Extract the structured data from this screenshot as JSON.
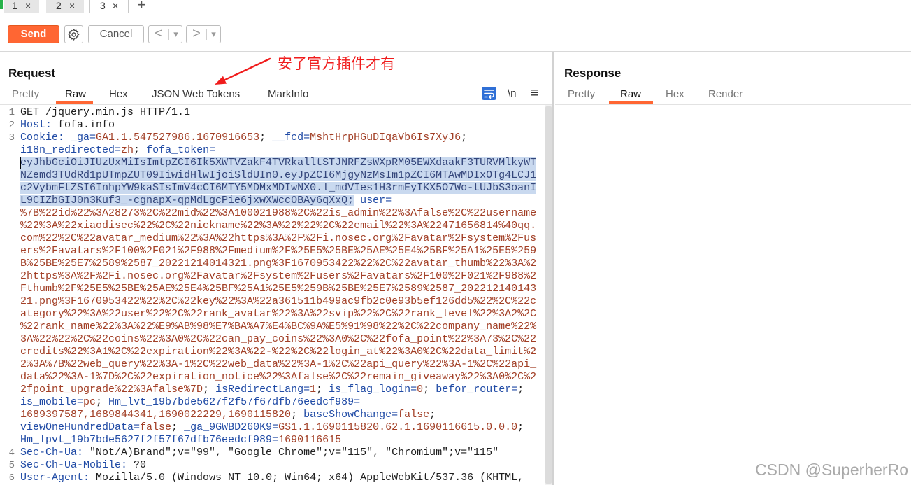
{
  "tabs": [
    {
      "label": "1",
      "close": "×"
    },
    {
      "label": "2",
      "close": "×"
    },
    {
      "label": "3",
      "close": "×"
    }
  ],
  "new_tab": "+",
  "toolbar": {
    "send": "Send",
    "settings_icon": "gear-icon",
    "cancel": "Cancel",
    "back": "<",
    "back_dropdown": "▾",
    "forward": ">",
    "forward_dropdown": "▾"
  },
  "annotation": "安了官方插件才有",
  "request": {
    "title": "Request",
    "tabs": [
      "Pretty",
      "Raw",
      "Hex",
      "JSON Web Tokens",
      "MarkInfo"
    ],
    "active_tab": "Raw",
    "actions": {
      "wrap_icon": "wrap-lines-icon",
      "newline": "\\n",
      "menu": "≡"
    },
    "lines": [
      {
        "n": "1",
        "segs": [
          {
            "text": "GET /jquery.min.js HTTP/1.1"
          }
        ]
      },
      {
        "n": "2",
        "segs": [
          {
            "name": "Host:"
          },
          {
            "text": " fofa.info"
          }
        ]
      },
      {
        "n": "3",
        "segs": [
          {
            "name": "Cookie:"
          },
          {
            "text": " "
          },
          {
            "name": "_ga="
          },
          {
            "value": "GA1.1.547527986.1670916653"
          },
          {
            "text": "; "
          },
          {
            "name": "__fcd="
          },
          {
            "value": "MshtHrpHGuDIqaVb6Is7XyJ6"
          },
          {
            "text": ";"
          }
        ]
      },
      {
        "segs": [
          {
            "name": "i18n_redirected="
          },
          {
            "value": "zh"
          },
          {
            "text": "; "
          },
          {
            "name": "fofa_token="
          }
        ]
      },
      {
        "segs": [
          {
            "selected": "eyJhbGciOiJIUzUxMiIsImtpZCI6Ik5XWTVZakF4TVRkalltSTJNRFZsWXpRM05EWXdaakF3TURVMlkyWT"
          }
        ]
      },
      {
        "segs": [
          {
            "selected": "NZemd3TUdRd1pUTmpZUT09IiwidHlwIjoiSldUIn0.eyJpZCI6MjgyNzMsIm1pZCI6MTAwMDIxOTg4LCJ1"
          }
        ]
      },
      {
        "segs": [
          {
            "selected": "c2VybmFtZSI6InhpYW9kaSIsImV4cCI6MTY5MDMxMDIwNX0.l_mdVIes1H3rmEyIKX5O7Wo-tUJbS3oanI"
          }
        ]
      },
      {
        "segs": [
          {
            "selected": "L9CIZbGIJ0n3Kuf3_-cgnapX-qpMdLgcPie6jxwXWccOBAy6qXxQ;"
          },
          {
            "text": " "
          },
          {
            "name": "user="
          }
        ]
      },
      {
        "segs": [
          {
            "value": "%7B%22id%22%3A28273%2C%22mid%22%3A100021988%2C%22is_admin%22%3Afalse%2C%22username"
          }
        ]
      },
      {
        "segs": [
          {
            "value": "%22%3A%22xiaodisec%22%2C%22nickname%22%3A%22%22%2C%22email%22%3A%22471656814%40qq."
          }
        ]
      },
      {
        "segs": [
          {
            "value": "com%22%2C%22avatar_medium%22%3A%22https%3A%2F%2Fi.nosec.org%2Favatar%2Fsystem%2Fus"
          }
        ]
      },
      {
        "segs": [
          {
            "value": "ers%2Favatars%2F100%2F021%2F988%2Fmedium%2F%25E5%25BE%25AE%25E4%25BF%25A1%25E5%259"
          }
        ]
      },
      {
        "segs": [
          {
            "value": "B%25BE%25E7%2589%2587_20221214014321.png%3F1670953422%22%2C%22avatar_thumb%22%3A%2"
          }
        ]
      },
      {
        "segs": [
          {
            "value": "2https%3A%2F%2Fi.nosec.org%2Favatar%2Fsystem%2Fusers%2Favatars%2F100%2F021%2F988%2"
          }
        ]
      },
      {
        "segs": [
          {
            "value": "Fthumb%2F%25E5%25BE%25AE%25E4%25BF%25A1%25E5%259B%25BE%25E7%2589%2587_202212140143"
          }
        ]
      },
      {
        "segs": [
          {
            "value": "21.png%3F1670953422%22%2C%22key%22%3A%22a361511b499ac9fb2c0e93b5ef126dd5%22%2C%22c"
          }
        ]
      },
      {
        "segs": [
          {
            "value": "ategory%22%3A%22user%22%2C%22rank_avatar%22%3A%22svip%22%2C%22rank_level%22%3A2%2C"
          }
        ]
      },
      {
        "segs": [
          {
            "value": "%22rank_name%22%3A%22%E9%AB%98%E7%BA%A7%E4%BC%9A%E5%91%98%22%2C%22company_name%22%"
          }
        ]
      },
      {
        "segs": [
          {
            "value": "3A%22%22%2C%22coins%22%3A0%2C%22can_pay_coins%22%3A0%2C%22fofa_point%22%3A73%2C%22"
          }
        ]
      },
      {
        "segs": [
          {
            "value": "credits%22%3A1%2C%22expiration%22%3A%22-%22%2C%22login_at%22%3A0%2C%22data_limit%2"
          }
        ]
      },
      {
        "segs": [
          {
            "value": "2%3A%7B%22web_query%22%3A-1%2C%22web_data%22%3A-1%2C%22api_query%22%3A-1%2C%22api_"
          }
        ]
      },
      {
        "segs": [
          {
            "value": "data%22%3A-1%7D%2C%22expiration_notice%22%3Afalse%2C%22remain_giveaway%22%3A0%2C%2"
          }
        ]
      },
      {
        "segs": [
          {
            "value": "2fpoint_upgrade%22%3Afalse%7D"
          },
          {
            "text": "; "
          },
          {
            "name": "isRedirectLang="
          },
          {
            "value": "1"
          },
          {
            "text": "; "
          },
          {
            "name": "is_flag_login="
          },
          {
            "value": "0"
          },
          {
            "text": "; "
          },
          {
            "name": "befor_router="
          },
          {
            "text": ";"
          }
        ]
      },
      {
        "segs": [
          {
            "name": "is_mobile="
          },
          {
            "value": "pc"
          },
          {
            "text": "; "
          },
          {
            "name": "Hm_lvt_19b7bde5627f2f57f67dfb76eedcf989="
          }
        ]
      },
      {
        "segs": [
          {
            "value": "1689397587,1689844341,1690022229,1690115820"
          },
          {
            "text": "; "
          },
          {
            "name": "baseShowChange="
          },
          {
            "value": "false"
          },
          {
            "text": ";"
          }
        ]
      },
      {
        "segs": [
          {
            "name": "viewOneHundredData="
          },
          {
            "value": "false"
          },
          {
            "text": "; "
          },
          {
            "name": "_ga_9GWBD260K9="
          },
          {
            "value": "GS1.1.1690115820.62.1.1690116615.0.0.0"
          },
          {
            "text": ";"
          }
        ]
      },
      {
        "segs": [
          {
            "name": "Hm_lpvt_19b7bde5627f2f57f67dfb76eedcf989="
          },
          {
            "value": "1690116615"
          }
        ]
      },
      {
        "n": "4",
        "segs": [
          {
            "name": "Sec-Ch-Ua:"
          },
          {
            "text": " \"Not/A)Brand\";v=\"99\", \"Google Chrome\";v=\"115\", \"Chromium\";v=\"115\""
          }
        ]
      },
      {
        "n": "5",
        "segs": [
          {
            "name": "Sec-Ch-Ua-Mobile:"
          },
          {
            "text": " ?0"
          }
        ]
      },
      {
        "n": "6",
        "segs": [
          {
            "name": "User-Agent:"
          },
          {
            "text": " Mozilla/5.0 (Windows NT 10.0; Win64; x64) AppleWebKit/537.36 (KHTML,"
          }
        ]
      }
    ]
  },
  "response": {
    "title": "Response",
    "tabs": [
      "Pretty",
      "Raw",
      "Hex",
      "Render"
    ],
    "active_tab": "Raw"
  },
  "watermark": "CSDN @SuperherRo",
  "colors": {
    "send_button": "#ff6633",
    "active_tab_underline": "#ff6633",
    "header_name": "#1f4aa5",
    "cookie_value": "#a23f26",
    "selection": "#c9d9ef",
    "annotation": "#f01c1c",
    "wrap_toggle": "#2f6fd6"
  }
}
